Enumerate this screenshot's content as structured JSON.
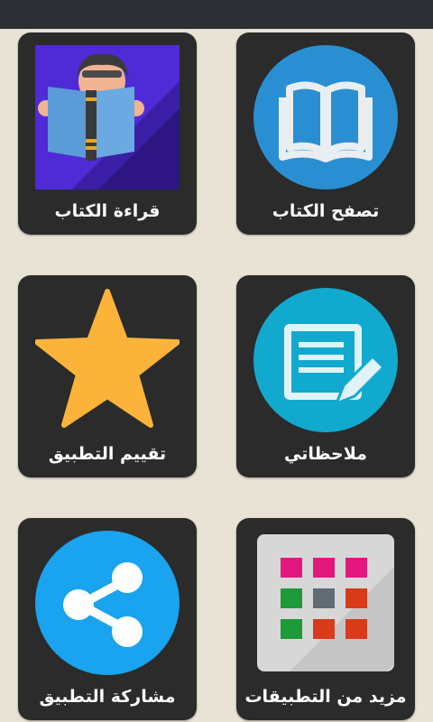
{
  "cards": [
    {
      "label": "قراءة الكتاب",
      "icon": "reading-person-icon"
    },
    {
      "label": "تصفح الكتاب",
      "icon": "open-book-icon"
    },
    {
      "label": "تقييم التطبيق",
      "icon": "star-icon"
    },
    {
      "label": "ملاحظاتي",
      "icon": "notes-edit-icon"
    },
    {
      "label": "مشاركة التطبيق",
      "icon": "share-icon"
    },
    {
      "label": "مزيد من التطبيقات",
      "icon": "apps-grid-icon"
    }
  ],
  "colors": {
    "background": "#e8e3d5",
    "status_bar": "#2c3034",
    "card": "#2b2b2b",
    "label_text": "#ffffff",
    "reading_bg": "#4f2bd8",
    "book_blue_circle": "#2a8fd2",
    "star": "#fbb33a",
    "notes_circle": "#12a9cf",
    "share_circle": "#1aa3ee",
    "apps_tile": "#d7d7d7"
  }
}
